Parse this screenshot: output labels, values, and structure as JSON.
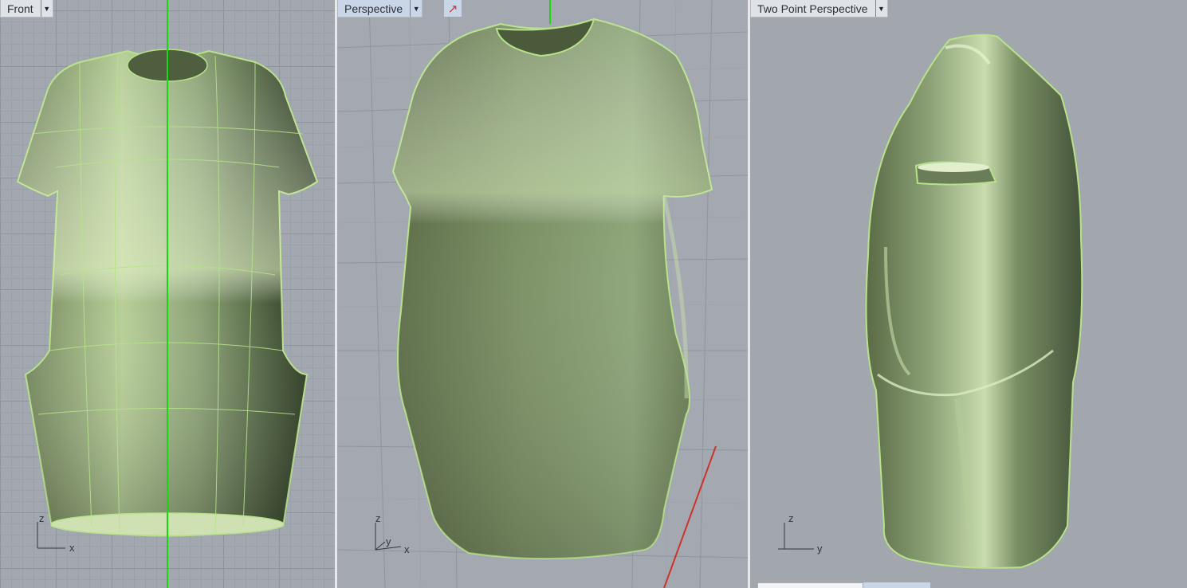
{
  "viewports": {
    "front": {
      "title": "Front",
      "axis": {
        "vertical": "z",
        "horizontal": "x"
      }
    },
    "perspective": {
      "title": "Perspective",
      "axis": {
        "vertical": "z",
        "depth": "y",
        "horizontal": "x"
      }
    },
    "two_point": {
      "title": "Two Point Perspective",
      "axis": {
        "vertical": "z",
        "horizontal": "y"
      }
    }
  },
  "colors": {
    "garment_base": "#7f9369",
    "garment_highlight": "#d5e6b8",
    "garment_shadow": "#3c4a30",
    "edge_green": "#b7e28a",
    "axis_green": "#19d80e",
    "axis_red": "#c9342b"
  },
  "icons": {
    "dropdown": "chevron-down-icon",
    "cursor": "cursor-icon"
  }
}
